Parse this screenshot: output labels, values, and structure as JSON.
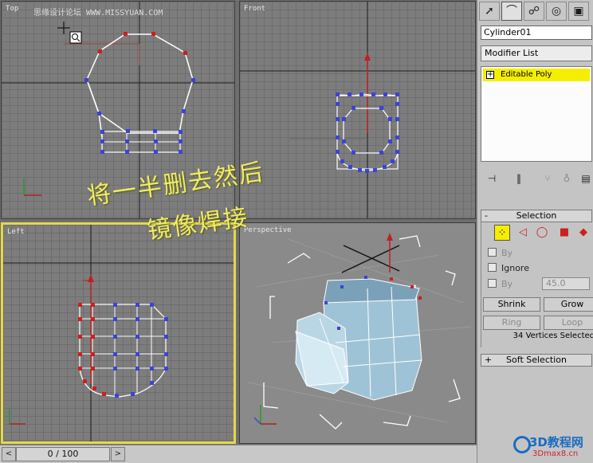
{
  "viewports": {
    "top": {
      "label": "Top"
    },
    "front": {
      "label": "Front"
    },
    "left": {
      "label": "Left"
    },
    "perspective": {
      "label": "Perspective"
    },
    "active": "left"
  },
  "watermark": "思缘设计论坛 WWW.MISSYUAN.COM",
  "annotation": {
    "line1": "将一半删去然后",
    "line2": "镜像焊接"
  },
  "timeline": {
    "frame_display": "0 / 100"
  },
  "command_panel": {
    "tabs": [
      {
        "name": "create",
        "icon": "cursor-icon"
      },
      {
        "name": "modify",
        "icon": "bend-icon"
      },
      {
        "name": "hierarchy",
        "icon": "hierarchy-icon"
      },
      {
        "name": "motion",
        "icon": "motion-icon"
      },
      {
        "name": "display",
        "icon": "display-icon"
      }
    ],
    "object_name": "Cylinder01",
    "modifier_list": "Modifier List",
    "stack": [
      {
        "label": "Editable Poly",
        "expander": "+"
      }
    ],
    "selection": {
      "header": "Selection",
      "header_sign": "-",
      "by_vertex": "By",
      "ignore": "Ignore",
      "by_angle": "By",
      "angle_value": "45.0",
      "shrink": "Shrink",
      "grow": "Grow",
      "ring": "Ring",
      "loop": "Loop",
      "status": "34 Vertices Selected"
    },
    "soft_selection": {
      "header": "Soft Selection",
      "header_sign": "+"
    }
  },
  "logo": {
    "main": "3D教程网",
    "sub": "3Dmax8.cn"
  },
  "colors": {
    "viewport_bg": "#7d7d7d",
    "active_border": "#e6d84a",
    "wire": "#ffffff",
    "vertex": "#3c44d4",
    "selected_vertex": "#cc1f1f",
    "stack_highlight": "#f6ee00",
    "annotation": "#f0ec6a"
  }
}
